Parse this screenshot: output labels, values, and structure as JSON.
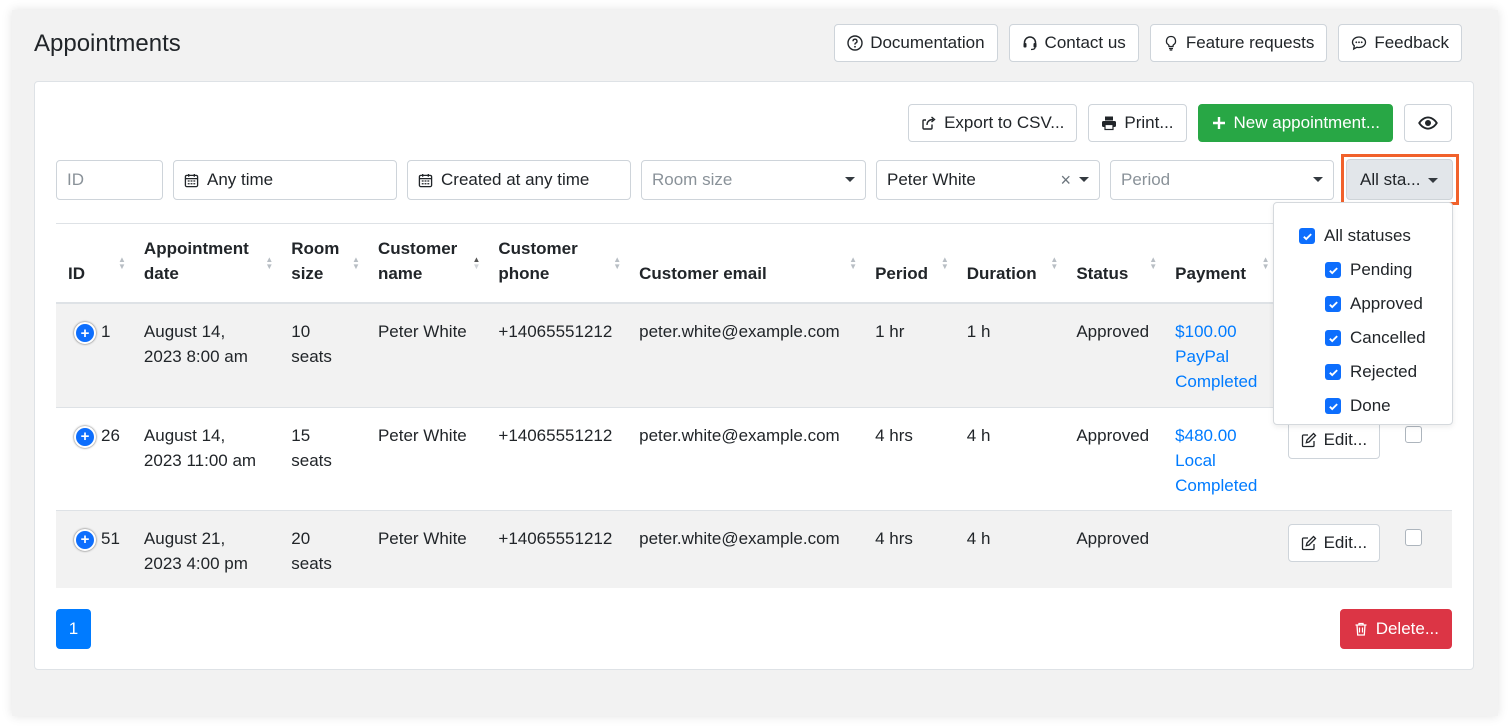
{
  "header": {
    "title": "Appointments",
    "buttons": {
      "documentation": "Documentation",
      "contact": "Contact us",
      "feature_requests": "Feature requests",
      "feedback": "Feedback"
    }
  },
  "toolbar": {
    "export": "Export to CSV...",
    "print": "Print...",
    "new_appointment": "New appointment..."
  },
  "filters": {
    "id_placeholder": "ID",
    "date": "Any time",
    "created": "Created at any time",
    "room_size_placeholder": "Room size",
    "customer": "Peter White",
    "clear": "×",
    "period_placeholder": "Period",
    "status": "All sta..."
  },
  "table": {
    "headers": {
      "id": "ID",
      "date_1": "Appointment",
      "date_2": "date",
      "room_1": "Room",
      "room_2": "size",
      "name_1": "Customer",
      "name_2": "name",
      "phone_1": "Customer",
      "phone_2": "phone",
      "email": "Customer email",
      "period": "Period",
      "duration": "Duration",
      "status": "Status",
      "payment": "Payment"
    },
    "rows": [
      {
        "id": "1",
        "date_1": "August 14,",
        "date_2": "2023 8:00 am",
        "room_1": "10",
        "room_2": "seats",
        "name": "Peter White",
        "phone": "+14065551212",
        "email": "peter.white@example.com",
        "period": "1 hr",
        "duration": "1 h",
        "status": "Approved",
        "pay_1": "$100.00",
        "pay_2": "PayPal",
        "pay_3": "Completed",
        "edit": ""
      },
      {
        "id": "26",
        "date_1": "August 14,",
        "date_2": "2023 11:00 am",
        "room_1": "15",
        "room_2": "seats",
        "name": "Peter White",
        "phone": "+14065551212",
        "email": "peter.white@example.com",
        "period": "4 hrs",
        "duration": "4 h",
        "status": "Approved",
        "pay_1": "$480.00",
        "pay_2": "Local",
        "pay_3": "Completed",
        "edit": "Edit..."
      },
      {
        "id": "51",
        "date_1": "August 21,",
        "date_2": "2023 4:00 pm",
        "room_1": "20",
        "room_2": "seats",
        "name": "Peter White",
        "phone": "+14065551212",
        "email": "peter.white@example.com",
        "period": "4 hrs",
        "duration": "4 h",
        "status": "Approved",
        "pay_1": "",
        "pay_2": "",
        "pay_3": "",
        "edit": "Edit..."
      }
    ]
  },
  "status_dropdown": {
    "all": "All statuses",
    "items": [
      "Pending",
      "Approved",
      "Cancelled",
      "Rejected",
      "Done"
    ]
  },
  "pagination": {
    "current": "1"
  },
  "delete_label": "Delete...",
  "colors": {
    "primary": "#007bff",
    "success": "#28a745",
    "danger": "#dc3545",
    "highlight": "#f1612b"
  }
}
